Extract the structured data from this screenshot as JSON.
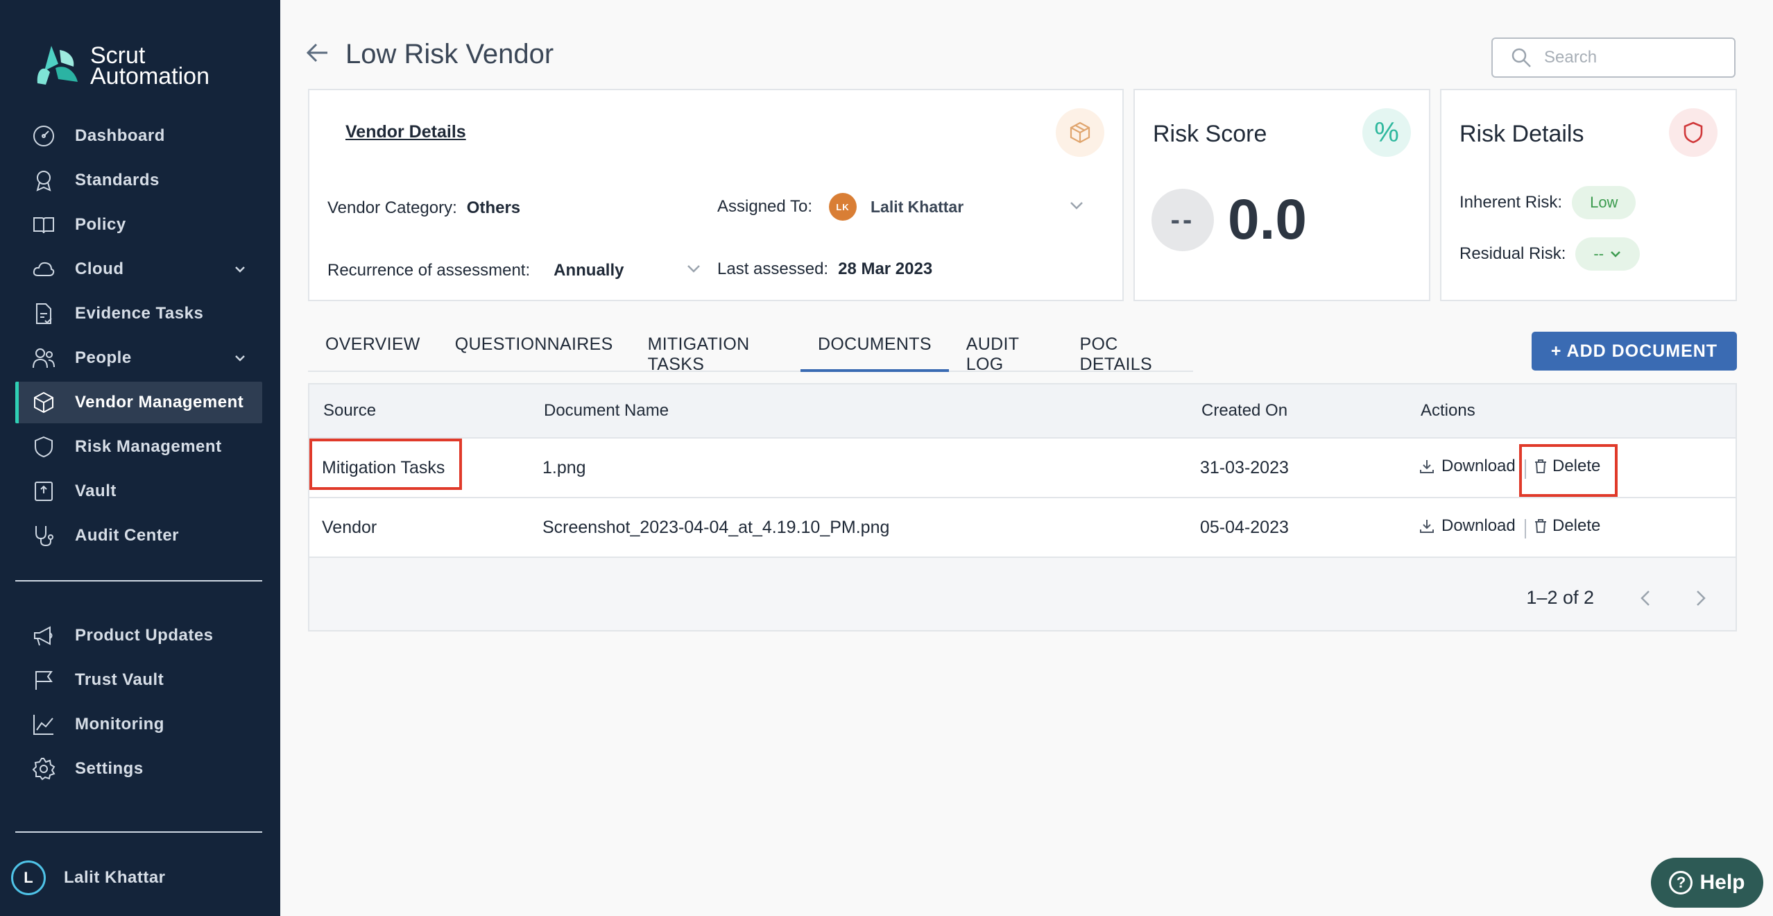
{
  "brand": {
    "line1": "Scrut",
    "line2": "Automation"
  },
  "sidebar": {
    "items": [
      {
        "label": "Dashboard",
        "icon": "dashboard-icon"
      },
      {
        "label": "Standards",
        "icon": "badge-icon"
      },
      {
        "label": "Policy",
        "icon": "book-icon"
      },
      {
        "label": "Cloud",
        "icon": "cloud-icon"
      },
      {
        "label": "Evidence Tasks",
        "icon": "document-check-icon"
      },
      {
        "label": "People",
        "icon": "people-icon"
      },
      {
        "label": "Vendor Management",
        "icon": "cube-icon"
      },
      {
        "label": "Risk Management",
        "icon": "shield-icon"
      },
      {
        "label": "Vault",
        "icon": "vault-icon"
      },
      {
        "label": "Audit Center",
        "icon": "stethoscope-icon"
      }
    ],
    "secondary": [
      {
        "label": "Product Updates",
        "icon": "megaphone-icon"
      },
      {
        "label": "Trust Vault",
        "icon": "flag-icon"
      },
      {
        "label": "Monitoring",
        "icon": "chart-line-icon"
      },
      {
        "label": "Settings",
        "icon": "gear-icon"
      }
    ],
    "user": {
      "initial": "L",
      "name": "Lalit Khattar"
    }
  },
  "header": {
    "title": "Low Risk Vendor",
    "search_placeholder": "Search"
  },
  "vendor_details": {
    "title": "Vendor Details",
    "category_label": "Vendor Category:",
    "category_value": "Others",
    "assigned_label": "Assigned To:",
    "assigned_initials": "LK",
    "assigned_value": "Lalit Khattar",
    "recurrence_label": "Recurrence of assessment:",
    "recurrence_value": "Annually",
    "last_assessed_label": "Last assessed:",
    "last_assessed_value": "28 Mar 2023"
  },
  "risk_score": {
    "title": "Risk Score",
    "icon_glyph": "%",
    "badge": "--",
    "value": "0.0"
  },
  "risk_details": {
    "title": "Risk Details",
    "inherent_label": "Inherent Risk:",
    "inherent_value": "Low",
    "residual_label": "Residual Risk:",
    "residual_value": "--"
  },
  "tabs": [
    "OVERVIEW",
    "QUESTIONNAIRES",
    "MITIGATION TASKS",
    "DOCUMENTS",
    "AUDIT LOG",
    "POC DETAILS"
  ],
  "active_tab": "DOCUMENTS",
  "add_document_label": "+ ADD DOCUMENT",
  "table": {
    "headers": [
      "Source",
      "Document Name",
      "Created On",
      "Actions"
    ],
    "rows": [
      {
        "source": "Mitigation Tasks",
        "name": "1.png",
        "created": "31-03-2023",
        "download": "Download",
        "delete": "Delete"
      },
      {
        "source": "Vendor",
        "name": "Screenshot_2023-04-04_at_4.19.10_PM.png",
        "created": "05-04-2023",
        "download": "Download",
        "delete": "Delete"
      }
    ],
    "pagination": "1–2 of 2"
  },
  "help_label": "Help",
  "help_glyph": "?",
  "colors": {
    "sidebar_bg": "#14243a",
    "accent": "#2fd0b5",
    "primary": "#3a6bb3",
    "highlight": "#e03a2a"
  }
}
